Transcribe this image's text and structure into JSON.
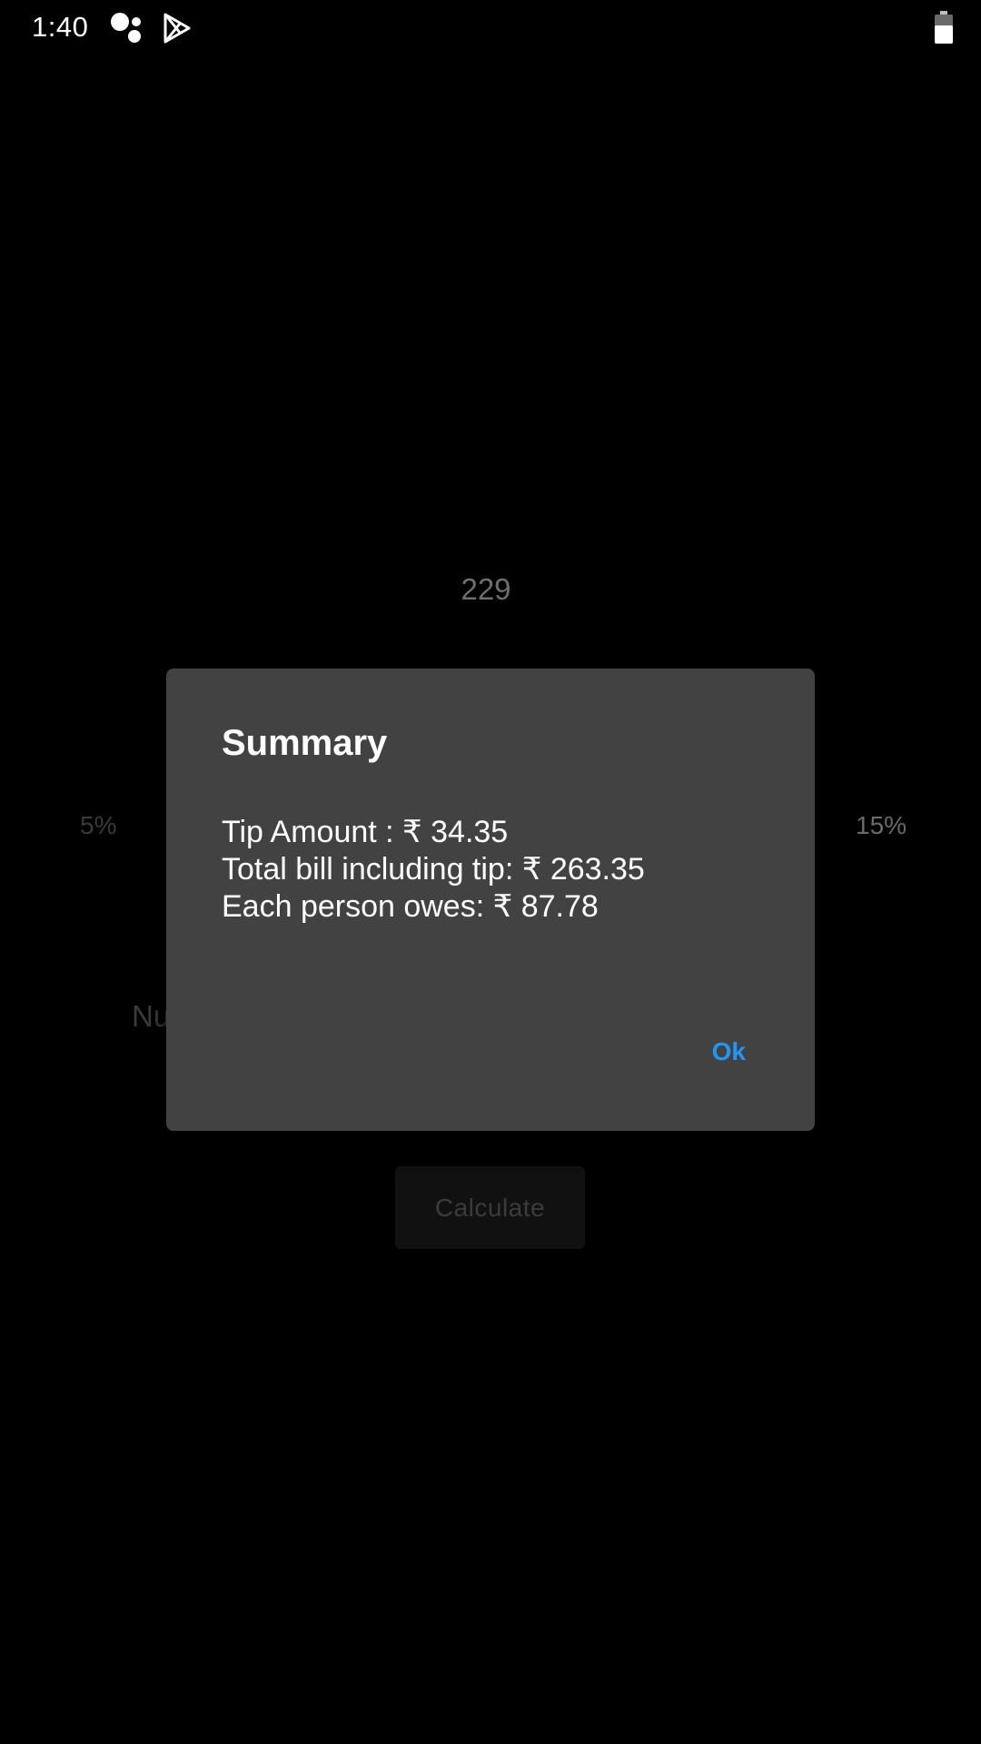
{
  "status_bar": {
    "time": "1:40",
    "icons": [
      "assistant-icon",
      "play-store-icon",
      "battery-icon"
    ]
  },
  "background": {
    "bill_value": "229",
    "tip_min_label": "5%",
    "tip_max_label": "15%",
    "people_label_partial": "Nu",
    "calculate_label": "Calculate"
  },
  "dialog": {
    "title": "Summary",
    "lines": [
      "Tip Amount : ₹ 34.35",
      "Total bill including tip: ₹ 263.35",
      "Each person owes: ₹ 87.78"
    ],
    "ok_label": "Ok"
  },
  "colors": {
    "background": "#000000",
    "dialog": "#424242",
    "accent": "#2196f3",
    "text": "#ffffff"
  }
}
